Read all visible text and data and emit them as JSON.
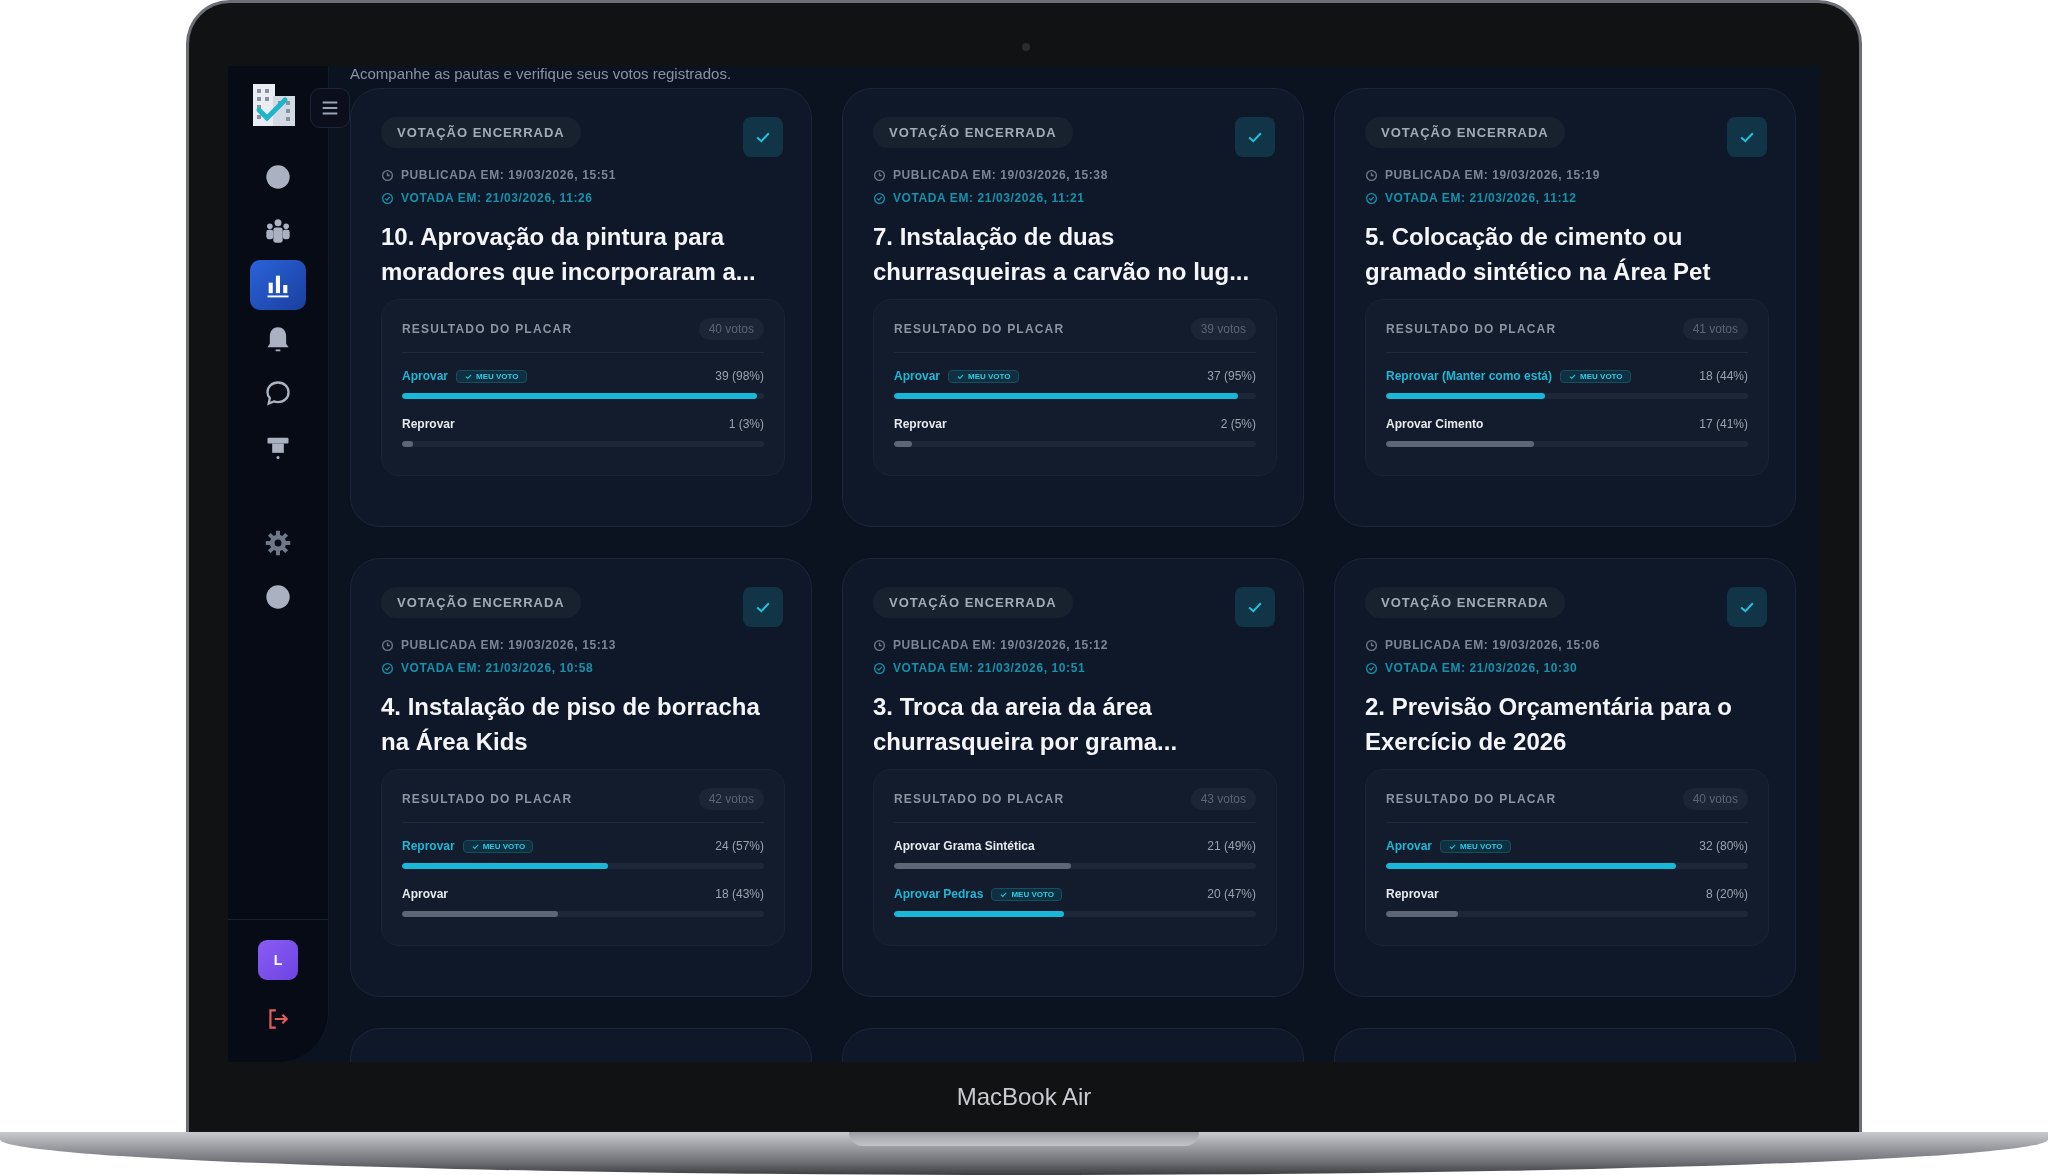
{
  "device": {
    "label": "MacBook Air"
  },
  "sidebar": {
    "items": [
      {
        "kind": "circle",
        "selected": false
      },
      {
        "kind": "people",
        "selected": false
      },
      {
        "kind": "chart",
        "selected": true
      },
      {
        "kind": "bell",
        "selected": false
      },
      {
        "kind": "chat",
        "selected": false
      },
      {
        "kind": "podium",
        "selected": false
      },
      {
        "kind": "gear",
        "selected": false
      },
      {
        "kind": "circle",
        "selected": false
      }
    ],
    "avatar": "L"
  },
  "subtitle": "Acompanhe as pautas e verifique seus votos registrados.",
  "cards": [
    {
      "status": "VOTAÇÃO ENCERRADA",
      "voted": true,
      "published": "PUBLICADA EM: 19/03/2026, 15:51",
      "voted_at": "VOTADA EM: 21/03/2026, 11:26",
      "title": "10. Aprovação da pintura para moradores que incorporaram a...",
      "results_title": "RESULTADO DO PLACAR",
      "votes": "40 votos",
      "my_vote_label": "MEU VOTO",
      "options": [
        {
          "label": "Aprovar",
          "my_vote": true,
          "reading": "39 (98%)",
          "level": 0.98
        },
        {
          "label": "Reprovar",
          "my_vote": false,
          "reading": "1 (3%)",
          "level": 0.03
        }
      ]
    },
    {
      "status": "VOTAÇÃO ENCERRADA",
      "voted": true,
      "published": "PUBLICADA EM: 19/03/2026, 15:38",
      "voted_at": "VOTADA EM: 21/03/2026, 11:21",
      "title": "7. Instalação de duas churrasqueiras a carvão no lug...",
      "results_title": "RESULTADO DO PLACAR",
      "votes": "39 votos",
      "my_vote_label": "MEU VOTO",
      "options": [
        {
          "label": "Aprovar",
          "my_vote": true,
          "reading": "37 (95%)",
          "level": 0.95
        },
        {
          "label": "Reprovar",
          "my_vote": false,
          "reading": "2 (5%)",
          "level": 0.05
        }
      ]
    },
    {
      "status": "VOTAÇÃO ENCERRADA",
      "voted": true,
      "published": "PUBLICADA EM: 19/03/2026, 15:19",
      "voted_at": "VOTADA EM: 21/03/2026, 11:12",
      "title": "5. Colocação de cimento ou gramado sintético na Área Pet",
      "results_title": "RESULTADO DO PLACAR",
      "votes": "41 votos",
      "my_vote_label": "MEU VOTO",
      "options": [
        {
          "label": "Reprovar (Manter como está)",
          "my_vote": true,
          "reading": "18 (44%)",
          "level": 0.44
        },
        {
          "label": "Aprovar Cimento",
          "my_vote": false,
          "reading": "17 (41%)",
          "level": 0.41
        }
      ]
    },
    {
      "status": "VOTAÇÃO ENCERRADA",
      "voted": true,
      "published": "PUBLICADA EM: 19/03/2026, 15:13",
      "voted_at": "VOTADA EM: 21/03/2026, 10:58",
      "title": "4. Instalação de piso de borracha na Área Kids",
      "results_title": "RESULTADO DO PLACAR",
      "votes": "42 votos",
      "my_vote_label": "MEU VOTO",
      "options": [
        {
          "label": "Reprovar",
          "my_vote": true,
          "reading": "24 (57%)",
          "level": 0.57
        },
        {
          "label": "Aprovar",
          "my_vote": false,
          "reading": "18 (43%)",
          "level": 0.43
        }
      ]
    },
    {
      "status": "VOTAÇÃO ENCERRADA",
      "voted": true,
      "published": "PUBLICADA EM: 19/03/2026, 15:12",
      "voted_at": "VOTADA EM: 21/03/2026, 10:51",
      "title": "3. Troca da areia da área churrasqueira por grama...",
      "results_title": "RESULTADO DO PLACAR",
      "votes": "43 votos",
      "my_vote_label": "MEU VOTO",
      "options": [
        {
          "label": "Aprovar Grama Sintética",
          "my_vote": false,
          "reading": "21 (49%)",
          "level": 0.49
        },
        {
          "label": "Aprovar Pedras",
          "my_vote": true,
          "reading": "20 (47%)",
          "level": 0.47
        }
      ]
    },
    {
      "status": "VOTAÇÃO ENCERRADA",
      "voted": true,
      "published": "PUBLICADA EM: 19/03/2026, 15:06",
      "voted_at": "VOTADA EM: 21/03/2026, 10:30",
      "title": "2. Previsão Orçamentária para o Exercício de 2026",
      "results_title": "RESULTADO DO PLACAR",
      "votes": "40 votos",
      "my_vote_label": "MEU VOTO",
      "options": [
        {
          "label": "Aprovar",
          "my_vote": true,
          "reading": "32 (80%)",
          "level": 0.8
        },
        {
          "label": "Reprovar",
          "my_vote": false,
          "reading": "8 (20%)",
          "level": 0.2
        }
      ]
    }
  ]
}
